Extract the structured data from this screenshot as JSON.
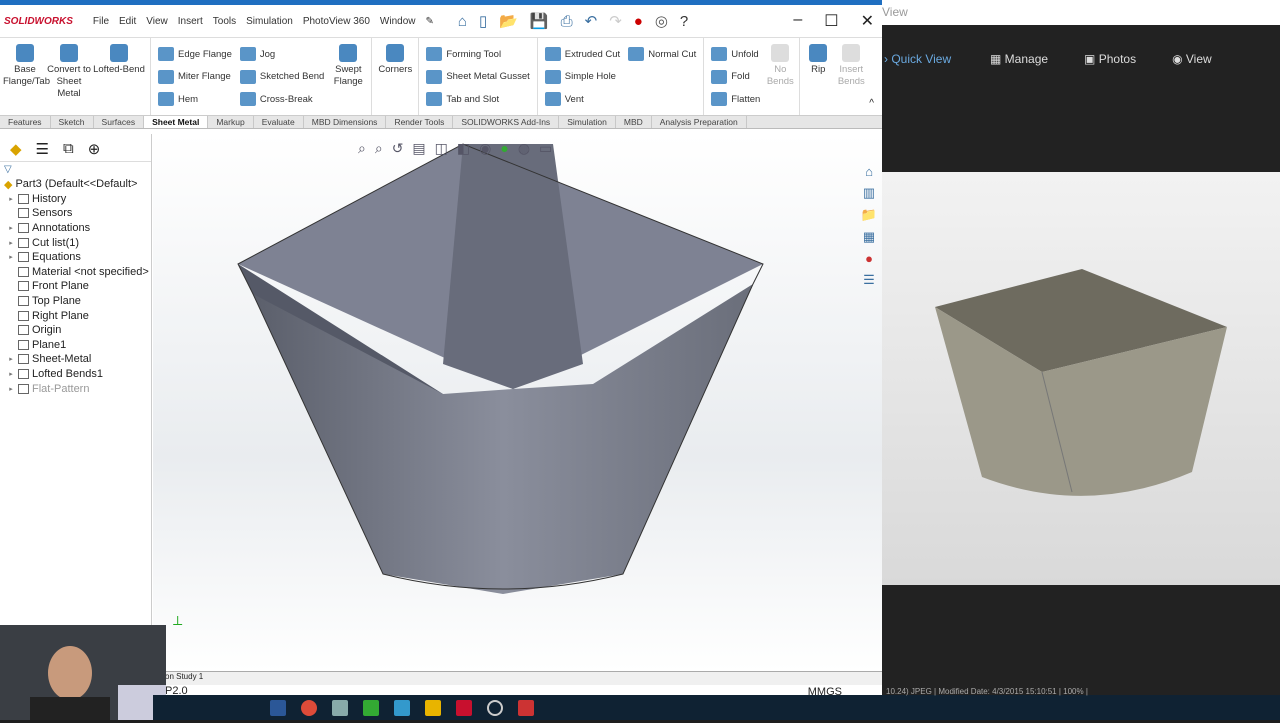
{
  "app": {
    "logo": "SOLIDWORKS",
    "menu": [
      "File",
      "Edit",
      "View",
      "Insert",
      "Tools",
      "Simulation",
      "PhotoView 360",
      "Window"
    ]
  },
  "ribbon": {
    "big1": [
      "Base Flange/Tab",
      "Convert to Sheet Metal",
      "Lofted-Bend"
    ],
    "col1": [
      "Edge Flange",
      "Miter Flange",
      "Hem"
    ],
    "col2": [
      "Jog",
      "Sketched Bend",
      "Cross-Break"
    ],
    "big2": [
      "Swept Flange",
      "Corners"
    ],
    "col3": [
      "Forming Tool",
      "Sheet Metal Gusset",
      "Tab and Slot"
    ],
    "col4": [
      "Extruded Cut",
      "Simple Hole",
      "Vent"
    ],
    "col5": [
      "Normal Cut"
    ],
    "col6": [
      "Unfold",
      "Fold",
      "Flatten"
    ],
    "big3": [
      "No Bends",
      "Rip",
      "Insert Bends"
    ]
  },
  "tabs": [
    "Features",
    "Sketch",
    "Surfaces",
    "Sheet Metal",
    "Markup",
    "Evaluate",
    "MBD Dimensions",
    "Render Tools",
    "SOLIDWORKS Add-Ins",
    "Simulation",
    "MBD",
    "Analysis Preparation"
  ],
  "tree": {
    "root": "Part3  (Default<<Default>",
    "items": [
      {
        "label": "History",
        "arrow": true
      },
      {
        "label": "Sensors",
        "arrow": false
      },
      {
        "label": "Annotations",
        "arrow": true
      },
      {
        "label": "Cut list(1)",
        "arrow": true
      },
      {
        "label": "Equations",
        "arrow": true
      },
      {
        "label": "Material <not specified>",
        "arrow": false
      },
      {
        "label": "Front Plane",
        "arrow": false
      },
      {
        "label": "Top Plane",
        "arrow": false
      },
      {
        "label": "Right Plane",
        "arrow": false
      },
      {
        "label": "Origin",
        "arrow": false
      },
      {
        "label": "Plane1",
        "arrow": false
      },
      {
        "label": "Sheet-Metal",
        "arrow": true
      },
      {
        "label": "Lofted Bends1",
        "arrow": true
      },
      {
        "label": "Flat-Pattern",
        "arrow": true
      }
    ]
  },
  "bottom_tab": "on Study 1",
  "status": {
    "left": "P2.0",
    "units": "MMGS"
  },
  "viewer": {
    "title": "View",
    "nav": [
      "Quick View",
      "Manage",
      "Photos",
      "View"
    ],
    "info": "10.24) JPEG | Modified Date: 4/3/2015 15:10:51 | 100% |"
  },
  "colors": {
    "accent": "#1f6fc1",
    "model": "#7b7f8e",
    "photo_model": "#9b9889"
  }
}
